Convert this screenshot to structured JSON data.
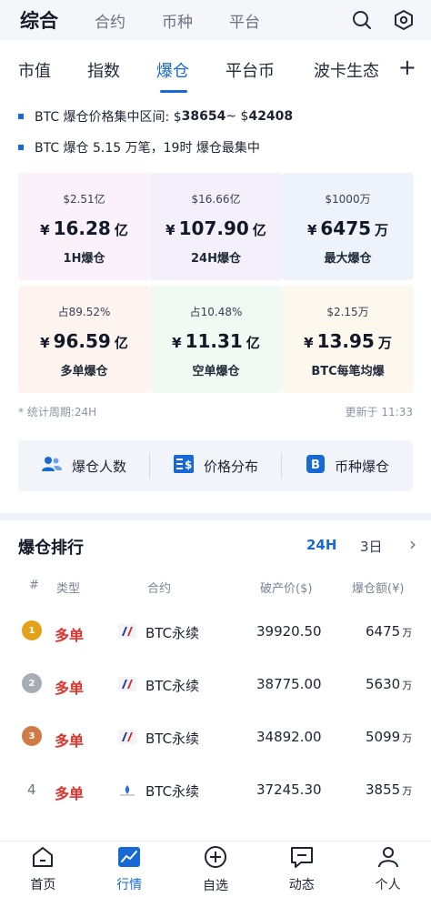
{
  "top_tabs": [
    {
      "label": "综合",
      "active": true
    },
    {
      "label": "合约",
      "active": false
    },
    {
      "label": "币种",
      "active": false
    },
    {
      "label": "平台",
      "active": false
    }
  ],
  "icons": {
    "search": "search-icon",
    "settings": "hexagon-settings-icon",
    "add": "plus-icon"
  },
  "sub_tabs": [
    {
      "label": "市值",
      "active": false
    },
    {
      "label": "指数",
      "active": false
    },
    {
      "label": "爆仓",
      "active": true
    },
    {
      "label": "平台币",
      "active": false
    },
    {
      "label": "波卡生态",
      "active": false
    }
  ],
  "plus_label": "+",
  "info": {
    "line1_prefix": "BTC 爆仓价格集中区间: $",
    "line1_low": "38654",
    "line1_sep": " ~ $",
    "line1_high": "42408",
    "line2": "BTC 爆仓 5.15 万笔，19时 爆仓最集中"
  },
  "cards": [
    {
      "sub": "$2.51亿",
      "currency": "¥",
      "value": "16.28",
      "unit": "亿",
      "label": "1H爆仓",
      "bg": "#fbf1fb"
    },
    {
      "sub": "$16.66亿",
      "currency": "¥",
      "value": "107.90",
      "unit": "亿",
      "label": "24H爆仓",
      "bg": "#f4f0fb"
    },
    {
      "sub": "$1000万",
      "currency": "¥",
      "value": "6475",
      "unit": "万",
      "label": "最大爆仓",
      "bg": "#eef3fb"
    },
    {
      "sub": "占89.52%",
      "currency": "¥",
      "value": "96.59",
      "unit": "亿",
      "label": "多单爆仓",
      "bg": "#fdf3ef"
    },
    {
      "sub": "占10.48%",
      "currency": "¥",
      "value": "11.31",
      "unit": "亿",
      "label": "空单爆仓",
      "bg": "#f1f9f3"
    },
    {
      "sub": "$2.15万",
      "currency": "¥",
      "value": "13.95",
      "unit": "万",
      "label": "BTC每笔均爆",
      "bg": "#fdf8ee"
    }
  ],
  "meta": {
    "period": "* 统计周期:24H",
    "updated": "更新于 11:33"
  },
  "shortcuts": [
    {
      "label": "爆仓人数",
      "icon": "users-icon"
    },
    {
      "label": "价格分布",
      "icon": "price-distribution-icon"
    },
    {
      "label": "币种爆仓",
      "icon": "bitcoin-icon"
    }
  ],
  "ranking": {
    "title": "爆仓排行",
    "periods": [
      {
        "label": "24H",
        "active": true
      },
      {
        "label": "3日",
        "active": false
      }
    ],
    "more": "›",
    "headers": {
      "rank": "#",
      "type": "类型",
      "contract": "合约",
      "price": "破产价($)",
      "amount": "爆仓额(¥)"
    },
    "rows": [
      {
        "rank": "1",
        "medal": "gold",
        "type": "多单",
        "contract": "BTC永续",
        "price": "39920.50",
        "amount": "6475",
        "unit": "万"
      },
      {
        "rank": "2",
        "medal": "silver",
        "type": "多单",
        "contract": "BTC永续",
        "price": "38775.00",
        "amount": "5630",
        "unit": "万"
      },
      {
        "rank": "3",
        "medal": "bronze",
        "type": "多单",
        "contract": "BTC永续",
        "price": "34892.00",
        "amount": "5099",
        "unit": "万"
      },
      {
        "rank": "4",
        "medal": "",
        "type": "多单",
        "contract": "BTC永续",
        "price": "37245.30",
        "amount": "3855",
        "unit": "万"
      }
    ]
  },
  "bottom_nav": [
    {
      "label": "首页",
      "icon": "home-icon",
      "active": false
    },
    {
      "label": "行情",
      "icon": "chart-icon",
      "active": true
    },
    {
      "label": "自选",
      "icon": "plus-circle-icon",
      "active": false
    },
    {
      "label": "动态",
      "icon": "message-icon",
      "active": false
    },
    {
      "label": "个人",
      "icon": "person-icon",
      "active": false
    }
  ],
  "colors": {
    "accent": "#1769d6",
    "long": "#e0322c",
    "gold": "#e3a21a",
    "silver": "#a7adb7",
    "bronze": "#d07a45"
  }
}
